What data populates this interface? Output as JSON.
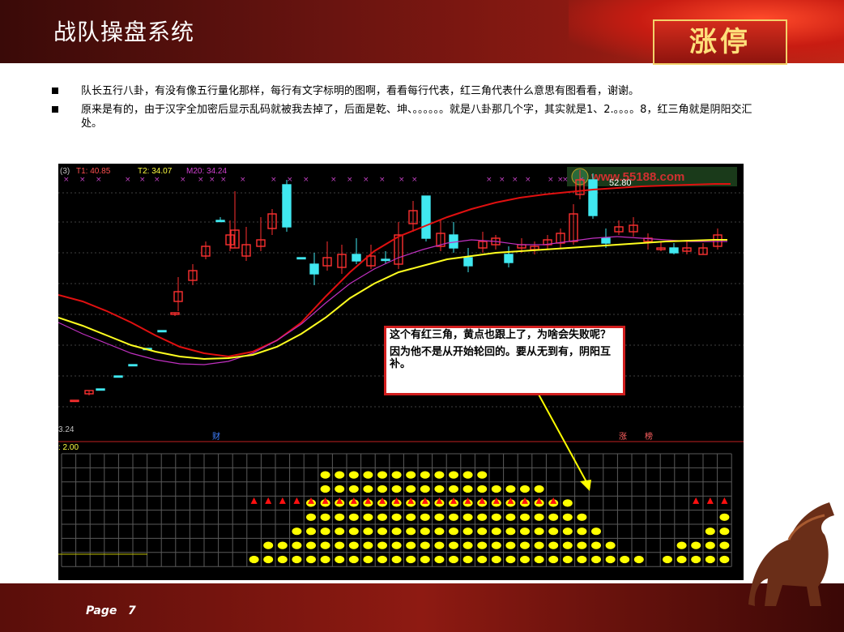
{
  "slide": {
    "title": "战队操盘系统",
    "logo_text": "涨停",
    "page_label": "Page",
    "page_number": "7"
  },
  "bullets": [
    "队长五行八卦，有没有像五行量化那样，每行有文字标明的图啊，看看每行代表，红三角代表什么意思有图看看，谢谢。",
    "原来是有的，由于汉字全加密后显示乱码就被我去掉了，后面是乾、坤、。。。。。。就是八卦那几个字，其实就是1、2.。。。。8，红三角就是阴阳交汇处。"
  ],
  "chart": {
    "panel_id": "(3)",
    "t1_label": "T1: 40.85",
    "t2_label": "T2: 34.07",
    "m20_label": "M20: 34.24",
    "watermark": "www.55188.com",
    "high_value": "52.80",
    "low_value": "3.24",
    "lower_scale": ": 2.00",
    "marker_cai": "财",
    "marker_zhang": "涨",
    "marker_bang": "榜",
    "callout_line1": "这个有红三角，黄点也跟上了，为啥会失败呢？",
    "callout_line2": "因为他不是从开始轮回的。要从无到有，阴阳互补。",
    "colors": {
      "up_candle": "#ff3030",
      "down_candle": "#40e8f0",
      "red_line": "#e01010",
      "yellow_line": "#ffff20",
      "magenta_line": "#c030c0",
      "dot": "#ffff00",
      "triangle": "#ff1010"
    }
  },
  "chart_data": {
    "type": "candlestick",
    "note_series": [
      "T1",
      "T2",
      "M20"
    ],
    "t1": 40.85,
    "t2": 34.07,
    "m20": 34.24,
    "y_max_label": 52.8,
    "y_min_label": 3.24,
    "lower_panel_scale": 2.0,
    "dot_column_heights": [
      0,
      0,
      0,
      0,
      0,
      0,
      0,
      1,
      2,
      2,
      3,
      5,
      7,
      7,
      7,
      7,
      7,
      7,
      7,
      7,
      7,
      7,
      7,
      7,
      6,
      6,
      6,
      6,
      5,
      5,
      4,
      3,
      2,
      1,
      1,
      0,
      1,
      2,
      2,
      3,
      4,
      4,
      5,
      4,
      5,
      4,
      3,
      3,
      3,
      2,
      1,
      1
    ],
    "triangle_columns": [
      7,
      8,
      9,
      10,
      11,
      12,
      13,
      14,
      15,
      16,
      17,
      18,
      19,
      20,
      21,
      22,
      23,
      24,
      25,
      26,
      27,
      28,
      38,
      39,
      40,
      41,
      42,
      43
    ]
  }
}
